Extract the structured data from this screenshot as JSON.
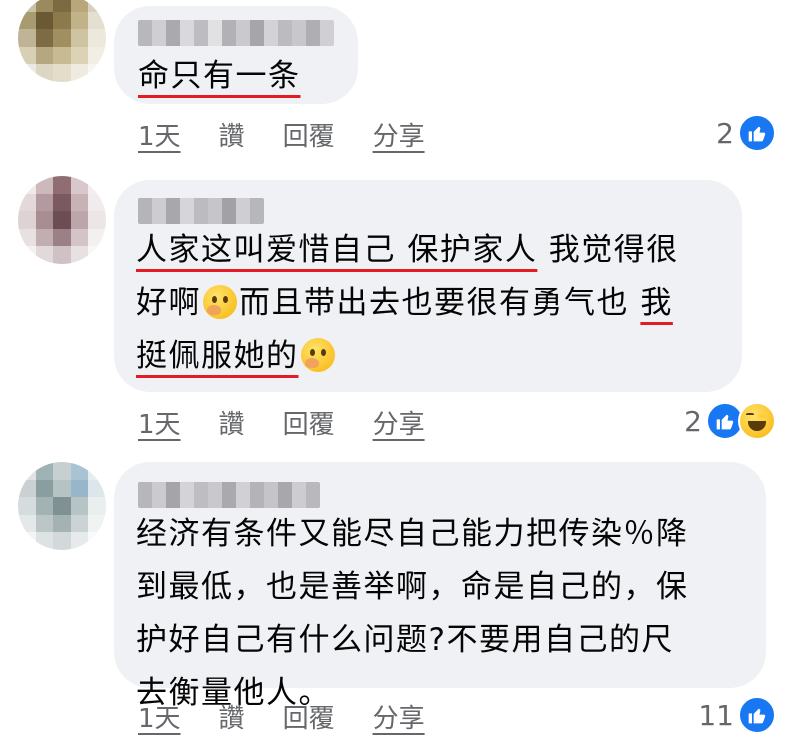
{
  "comments": [
    {
      "lines": [
        "命只有一条"
      ],
      "actions": {
        "time": "1天",
        "like": "讚",
        "reply": "回覆",
        "share": "分享"
      },
      "reaction_count": "2",
      "reactions": [
        "like"
      ]
    },
    {
      "lines": [
        [
          "人家这叫爱惜自己 保护家人",
          " 我觉得很"
        ],
        [
          "好啊",
          "而且带出去也要很有勇气也 ",
          "我"
        ],
        [
          "挺佩服她的"
        ]
      ],
      "actions": {
        "time": "1天",
        "like": "讚",
        "reply": "回覆",
        "share": "分享"
      },
      "reaction_count": "2",
      "reactions": [
        "like",
        "haha"
      ]
    },
    {
      "lines": [
        "经济有条件又能尽自己能力把传染％降",
        "到最低，也是善举啊，命是自己的，保",
        "护好自己有什么问题?不要用自己的尺",
        "去衡量他人。"
      ],
      "actions": {
        "time": "1天",
        "like": "讚",
        "reply": "回覆",
        "share": "分享"
      },
      "reaction_count": "11",
      "reactions": [
        "like"
      ]
    }
  ],
  "icons": {
    "like": "thumbs-up-icon",
    "haha": "laughing-emoji-icon",
    "thinking": "thinking-face-emoji"
  },
  "colors": {
    "bubble": "#eff1f5",
    "underline": "#e31b23",
    "action_text": "#65676b",
    "like_blue": "#1877f2"
  }
}
